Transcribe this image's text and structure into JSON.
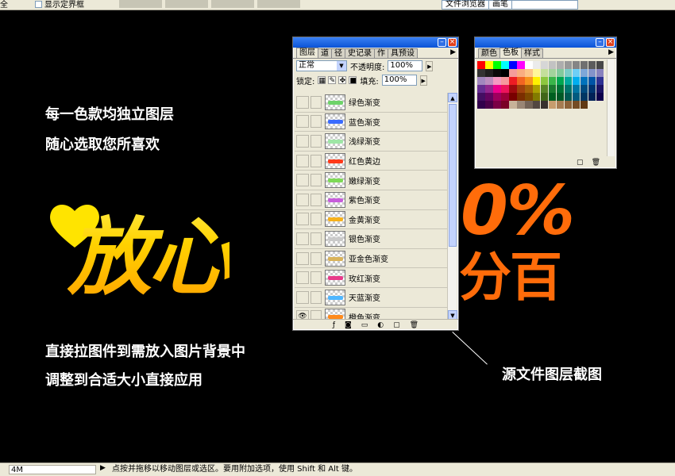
{
  "options_bar": {
    "left_fragment": "全",
    "checkbox_label": "显示定界框",
    "palette_well_tabs": [
      "文件浏览器",
      "画笔"
    ]
  },
  "canvas": {
    "line1": "每一色款均独立图层",
    "line2": "随心选取您所喜欢",
    "big_word": "放心",
    "percent": "0%",
    "baifen": "分百",
    "line3": "直接拉图件到需放入图片背景中",
    "line4": "调整到合适大小直接应用",
    "caption": "源文件图层截图"
  },
  "layers_panel": {
    "tabs": [
      "图层",
      "道",
      "径",
      "史记录",
      "作",
      "具预设"
    ],
    "blend_mode": "正常",
    "opacity_label": "不透明度:",
    "opacity_value": "100%",
    "lock_label": "锁定:",
    "fill_label": "填充:",
    "fill_value": "100%",
    "layers": [
      {
        "name": "绿色渐变",
        "color": "#6ed36a"
      },
      {
        "name": "蓝色渐变",
        "color": "#3a6bff"
      },
      {
        "name": "浅绿渐变",
        "color": "#9ee6a6"
      },
      {
        "name": "红色黄边",
        "color": "#ff3a1a"
      },
      {
        "name": "嫩绿渐变",
        "color": "#7ed957"
      },
      {
        "name": "紫色渐变",
        "color": "#c75ddb"
      },
      {
        "name": "金黄渐变",
        "color": "#f6b11b"
      },
      {
        "name": "银色渐变",
        "color": "#c9c9c9"
      },
      {
        "name": "亚金色渐变",
        "color": "#d9b35a"
      },
      {
        "name": "玫红渐变",
        "color": "#e83a8a"
      },
      {
        "name": "天蓝渐变",
        "color": "#4fb6ff"
      },
      {
        "name": "橙色渐变",
        "color": "#ff8a1c"
      }
    ]
  },
  "swatches_panel": {
    "tabs": [
      "颜色",
      "色板",
      "样式"
    ],
    "colors": [
      "#ff0000",
      "#ffff00",
      "#00ff00",
      "#00ffff",
      "#0000ff",
      "#ff00ff",
      "#ffffff",
      "#ebebeb",
      "#d6d6d6",
      "#c2c2c2",
      "#adadad",
      "#999999",
      "#858585",
      "#707070",
      "#5c5c5c",
      "#474747",
      "#333333",
      "#1f1f1f",
      "#0a0a0a",
      "#000000",
      "#f49c9c",
      "#f9ad81",
      "#fdc68a",
      "#fff79a",
      "#c4df9b",
      "#a2d39c",
      "#82ca9d",
      "#7bcdc8",
      "#6ecff6",
      "#7ea7d8",
      "#8493ca",
      "#8882be",
      "#a187be",
      "#bc8dbf",
      "#f49ac2",
      "#f6989d",
      "#ed1c24",
      "#f26522",
      "#f7941d",
      "#fff200",
      "#8dc73f",
      "#39b54a",
      "#00a651",
      "#00a99d",
      "#00aeef",
      "#0072bc",
      "#0054a6",
      "#2e3192",
      "#662d91",
      "#92278f",
      "#ec008c",
      "#ed145b",
      "#9e0b0f",
      "#a0410d",
      "#a36209",
      "#aba000",
      "#598527",
      "#1a7b30",
      "#007236",
      "#00746b",
      "#0076a3",
      "#004b80",
      "#003471",
      "#1b1464",
      "#440e62",
      "#630460",
      "#9e005d",
      "#9e0039",
      "#790000",
      "#7b2e00",
      "#7d4900",
      "#827b00",
      "#406618",
      "#005e20",
      "#005826",
      "#005952",
      "#005b7f",
      "#003663",
      "#002157",
      "#0d004c",
      "#32004b",
      "#4b0049",
      "#7b0046",
      "#7a0026",
      "#c7b299",
      "#998675",
      "#736357",
      "#534741",
      "#37302d",
      "#c69c6d",
      "#a67c52",
      "#8c6239",
      "#754c24",
      "#603913"
    ]
  },
  "status_bar": {
    "zoom": "4M",
    "message": "点按并拖移以移动图层或选区。要用附加选项，使用 Shift 和 Alt 键。"
  }
}
